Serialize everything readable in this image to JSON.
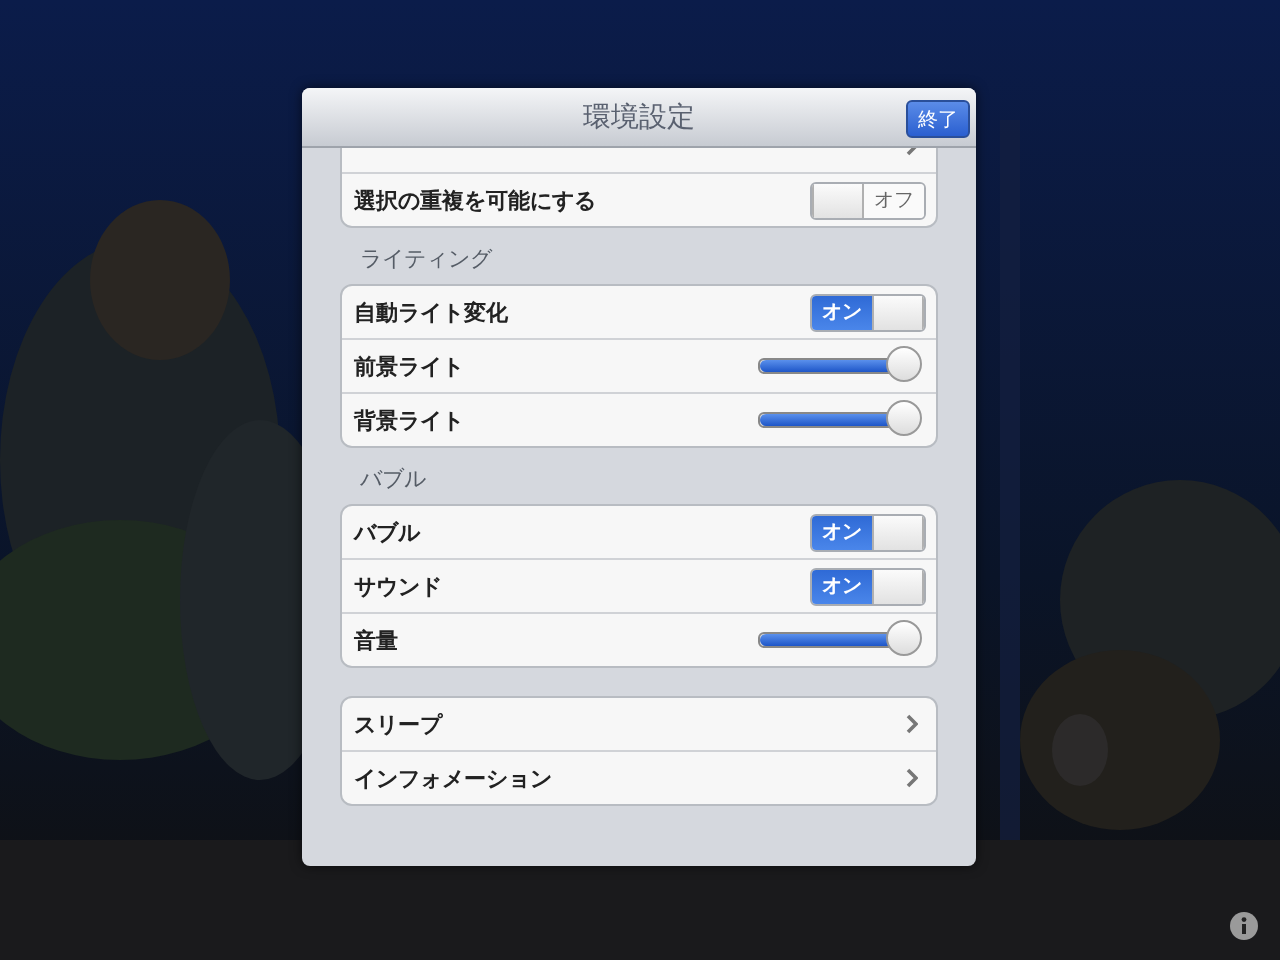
{
  "popover": {
    "title": "環境設定",
    "done_button": "終了"
  },
  "groups": [
    {
      "rows": [
        {
          "kind": "link"
        },
        {
          "kind": "toggle",
          "label": "選択の重複を可能にする",
          "on": false,
          "text": "オフ"
        }
      ]
    },
    {
      "header": "ライティング",
      "rows": [
        {
          "kind": "toggle",
          "label": "自動ライト変化",
          "on": true,
          "text": "オン"
        },
        {
          "kind": "slider",
          "label": "前景ライト",
          "level": 1.0
        },
        {
          "kind": "slider",
          "label": "背景ライト",
          "level": 1.0
        }
      ]
    },
    {
      "header": "バブル",
      "rows": [
        {
          "kind": "toggle",
          "label": "バブル",
          "on": true,
          "text": "オン"
        },
        {
          "kind": "toggle",
          "label": "サウンド",
          "on": true,
          "text": "オン"
        },
        {
          "kind": "slider",
          "label": "音量",
          "level": 1.0
        }
      ]
    },
    {
      "rows": [
        {
          "kind": "link",
          "label": "スリープ"
        },
        {
          "kind": "link",
          "label": "インフォメーション"
        }
      ]
    }
  ]
}
